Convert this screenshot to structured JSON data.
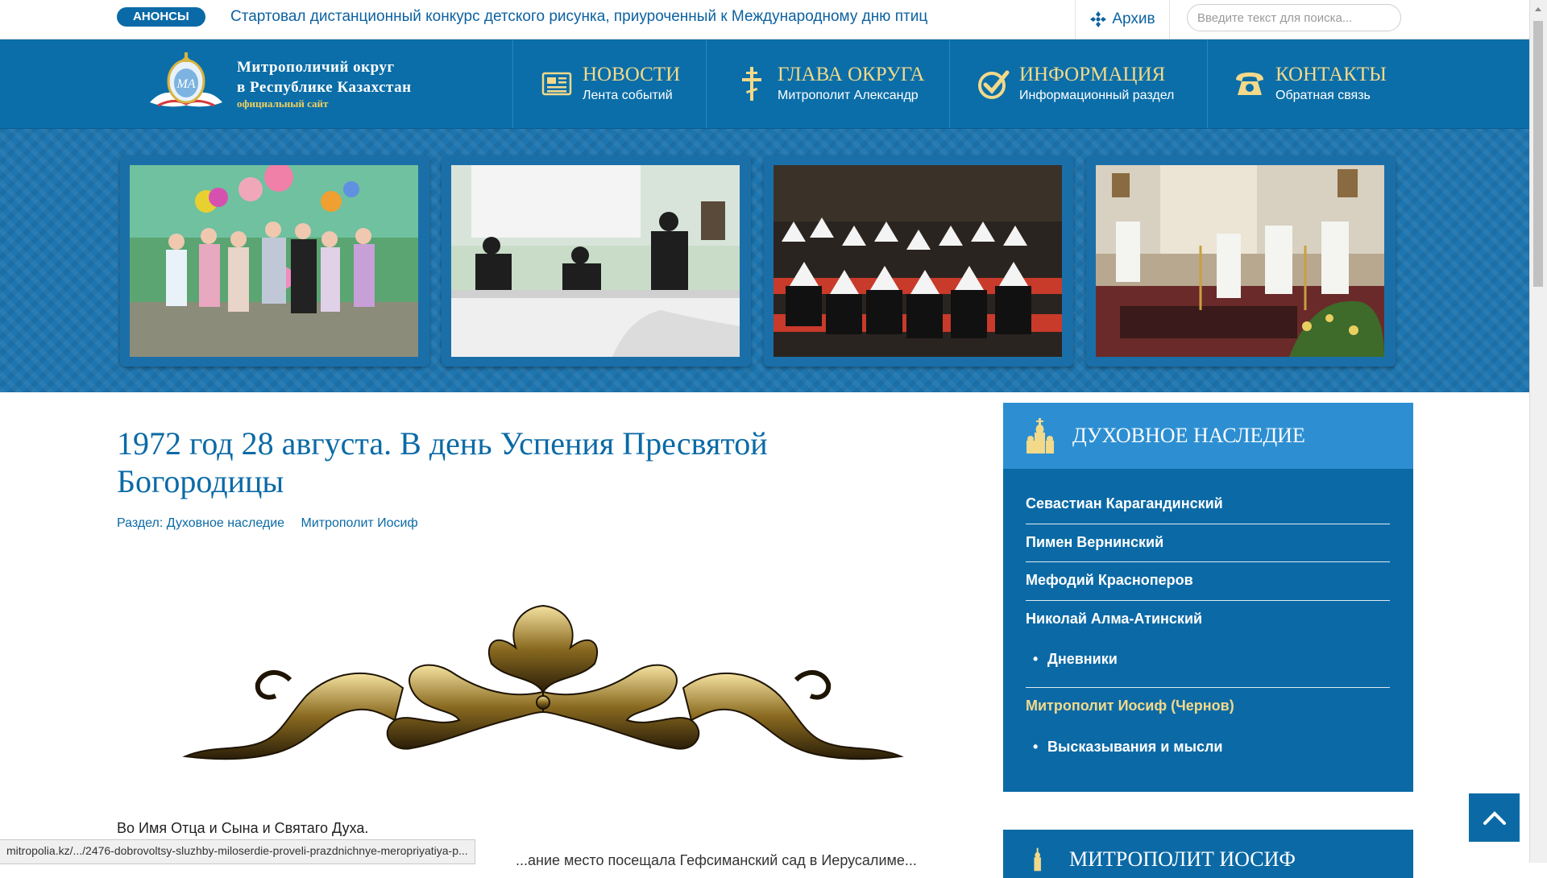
{
  "topbar": {
    "badge": "АНОНСЫ",
    "ticker": "Стартовал дистанционный конкурс детского рисунка, приуроченный к Международному дню птиц",
    "archive": "Архив",
    "search_placeholder": "Введите текст для поиска..."
  },
  "logo": {
    "line1": "Митрополичий округ",
    "line2": "в Республике Казахстан",
    "line3": "официальный сайт"
  },
  "nav": [
    {
      "title": "НОВОСТИ",
      "sub": "Лента событий",
      "icon": "newspaper-icon"
    },
    {
      "title": "ГЛАВА ОКРУГА",
      "sub": "Митрополит Александр",
      "icon": "orthodox-cross-icon"
    },
    {
      "title": "ИНФОРМАЦИЯ",
      "sub": "Информационный раздел",
      "icon": "check-circle-icon"
    },
    {
      "title": "КОНТАКТЫ",
      "sub": "Обратная связь",
      "icon": "telephone-icon"
    }
  ],
  "article": {
    "title": "1972 год 28 августа. В день Успения Пресвятой Богородицы",
    "section": "Раздел: Духовное наследие",
    "author": "Митрополит Иосиф",
    "para1": "Во Имя Отца и Сына и Святаго Духа.",
    "para2": "...ание место посещала Гефсиманский сад в Иерусалиме..."
  },
  "sidebar": {
    "title": "ДУХОВНОЕ НАСЛЕДИЕ",
    "items": [
      {
        "label": "Севастиан Карагандинский"
      },
      {
        "label": "Пимен Вернинский"
      },
      {
        "label": "Мефодий Красноперов"
      },
      {
        "label": "Николай Алма-Атинский"
      },
      {
        "label": "Дневники"
      },
      {
        "label": "Митрополит Иосиф (Чернов)"
      },
      {
        "label": "Высказывания и мысли"
      }
    ],
    "active_color": "#f3d98a",
    "second_title": "МИТРОПОЛИТ ИОСИФ"
  },
  "status_url": "mitropolia.kz/.../2476-dobrovoltsy-sluzhby-miloserdie-proveli-prazdnichnye-meropriyatiya-p...",
  "colors": {
    "primary": "#0b6ea8",
    "accent": "#f3d98a",
    "header": "#2d8fd2"
  }
}
